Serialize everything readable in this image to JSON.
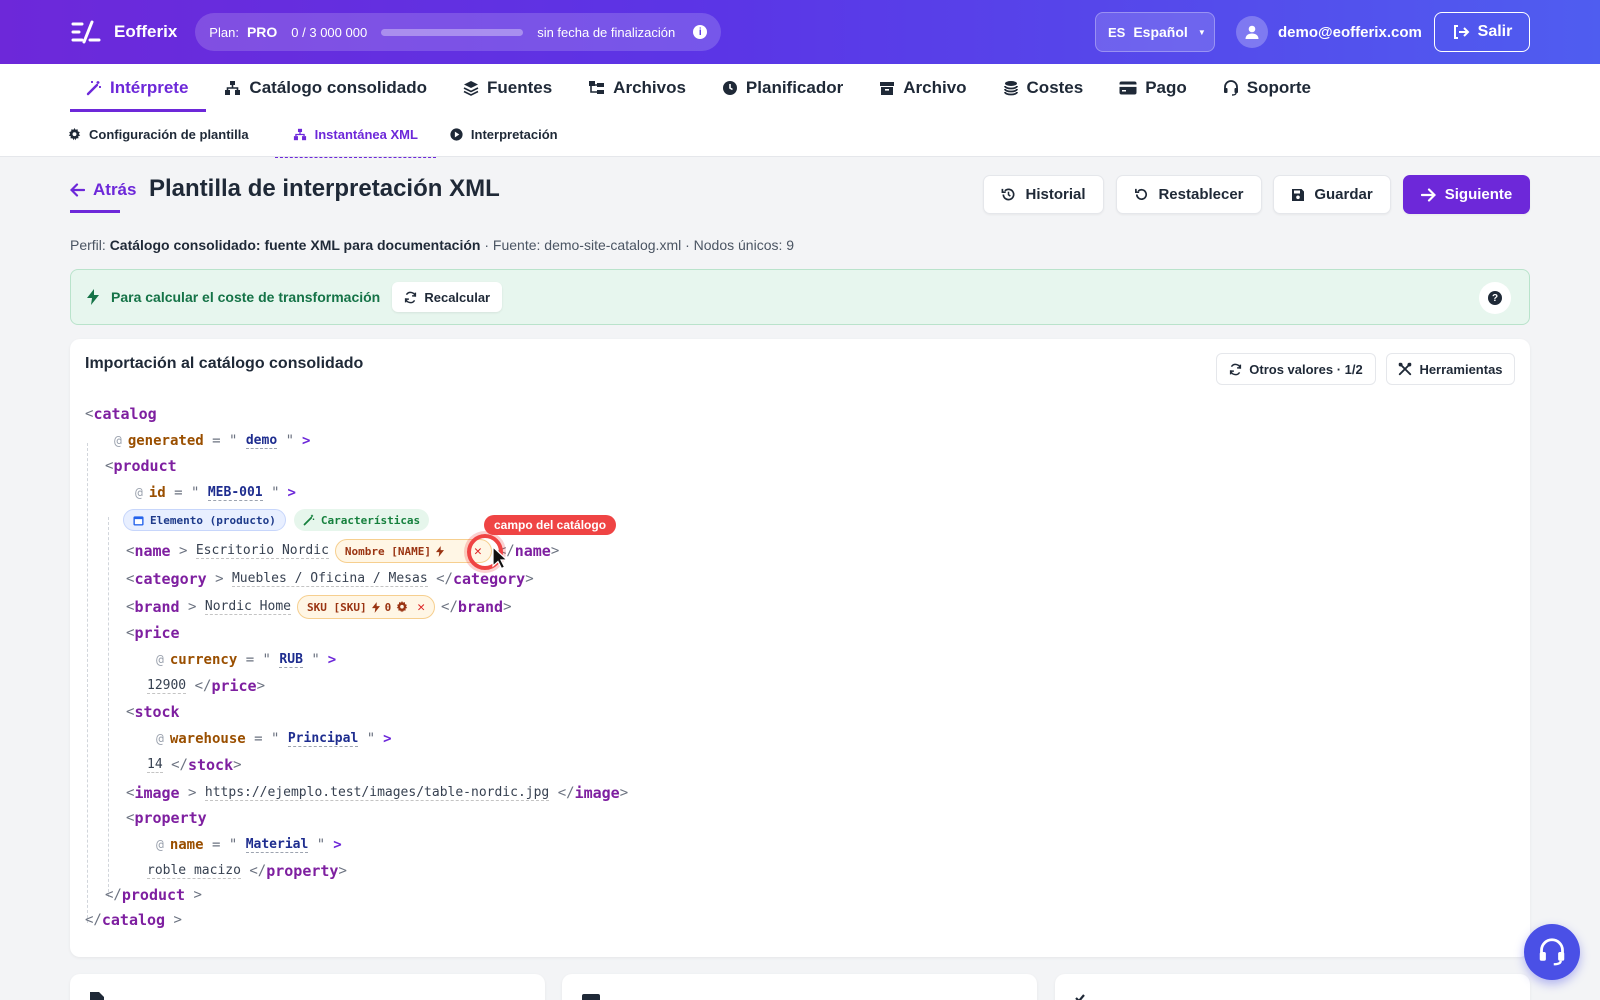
{
  "app": {
    "name": "Eofferix"
  },
  "plan": {
    "label": "Plan:",
    "value": "PRO",
    "usage": "0 / 3 000 000",
    "usage_fraction": 0,
    "expiry": "sin fecha de finalización"
  },
  "language": {
    "code": "ES",
    "label": "Español"
  },
  "user": {
    "email": "demo@eofferix.com"
  },
  "logout_label": "Salir",
  "nav": {
    "items": [
      {
        "label": "Intérprete",
        "icon": "magic-wand-icon",
        "active": true
      },
      {
        "label": "Catálogo consolidado",
        "icon": "sitemap-icon"
      },
      {
        "label": "Fuentes",
        "icon": "layers-icon"
      },
      {
        "label": "Archivos",
        "icon": "folder-tree-icon"
      },
      {
        "label": "Planificador",
        "icon": "clock-icon"
      },
      {
        "label": "Archivo",
        "icon": "archive-box-icon"
      },
      {
        "label": "Costes",
        "icon": "coins-icon"
      },
      {
        "label": "Pago",
        "icon": "credit-card-icon"
      },
      {
        "label": "Soporte",
        "icon": "headset-icon"
      }
    ],
    "subitems": [
      {
        "label": "Configuración de plantilla",
        "icon": "gear-icon"
      },
      {
        "label": "Instantánea XML",
        "icon": "sitemap-icon",
        "active": true
      },
      {
        "label": "Interpretación",
        "icon": "play-circle-icon"
      }
    ]
  },
  "page": {
    "back_label": "Atrás",
    "title": "Plantilla de interpretación XML",
    "actions": {
      "history": "Historial",
      "reset": "Restablecer",
      "save": "Guardar",
      "next": "Siguiente"
    },
    "profile": {
      "prefix": "Perfil:",
      "name": "Catálogo consolidado: fuente XML para documentación",
      "source": "· Fuente: demo-site-catalog.xml · Nodos únicos: 9"
    }
  },
  "alert": {
    "text": "Para calcular el coste de transformación",
    "button": "Recalcular",
    "help": "?"
  },
  "panel": {
    "title": "Importación al catálogo consolidado",
    "other_values": "Otros valores · 1/2",
    "tools": "Herramientas"
  },
  "xml": {
    "catalog_tag": "catalog",
    "catalog_attr": {
      "name": "generated",
      "value": "demo"
    },
    "product_tag": "product",
    "product_attr": {
      "name": "id",
      "value": "MEB-001"
    },
    "badges": {
      "element": "Elemento (producto)",
      "features": "Características"
    },
    "name": {
      "tag": "name",
      "text": "Escritorio Nordic",
      "chip": "Nombre [NAME]"
    },
    "tooltip": "campo del catálogo",
    "category": {
      "tag": "category",
      "text": "Muebles / Oficina / Mesas"
    },
    "brand": {
      "tag": "brand",
      "text": "Nordic Home",
      "chip": "SKU [SKU]",
      "chip_count": "0"
    },
    "price": {
      "tag": "price",
      "attr_name": "currency",
      "attr_value": "RUB",
      "text": "12900"
    },
    "stock": {
      "tag": "stock",
      "attr_name": "warehouse",
      "attr_value": "Principal",
      "text": "14"
    },
    "image": {
      "tag": "image",
      "text": "https://ejemplo.test/images/table-nordic.jpg"
    },
    "property": {
      "tag": "property",
      "attr_name": "name",
      "attr_value": "Material",
      "text": "roble macizo"
    }
  },
  "colors": {
    "brand": "#6d28d9",
    "accent_blue": "#4f5df0",
    "success": "#157347",
    "danger": "#ef4444"
  }
}
